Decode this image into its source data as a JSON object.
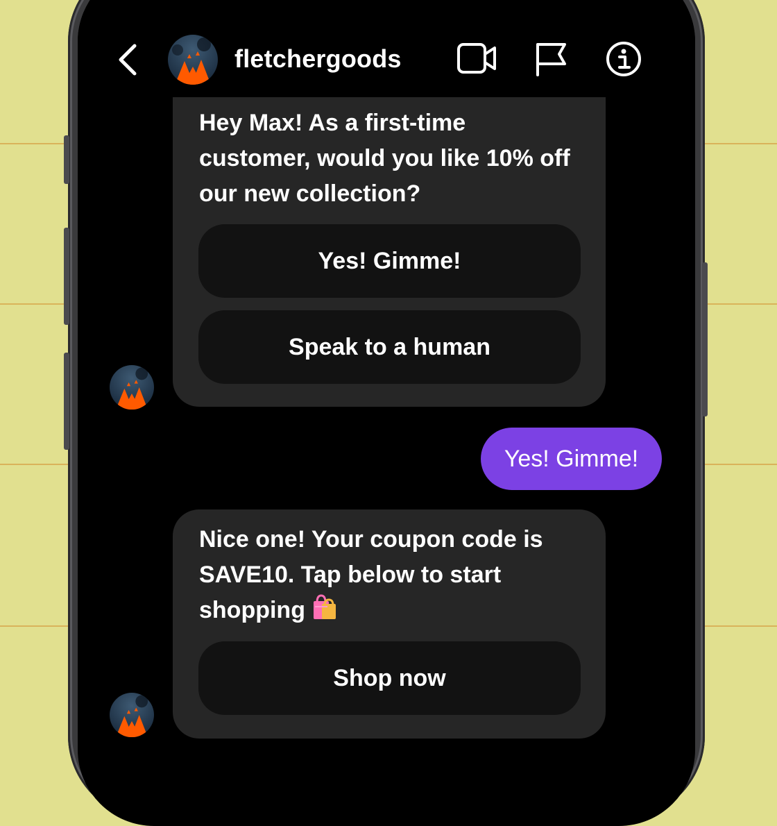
{
  "header": {
    "back_icon": "chevron-left-icon",
    "username": "fletchergoods",
    "video_icon": "video-camera-icon",
    "flag_icon": "flag-icon",
    "info_icon": "info-icon"
  },
  "messages": [
    {
      "from": "business",
      "text": "Hey Max! As a first-time customer, would you like 10% off our new collection?",
      "quick_replies": [
        "Yes! Gimme!",
        "Speak to a human"
      ]
    },
    {
      "from": "user",
      "text": "Yes! Gimme!"
    },
    {
      "from": "business",
      "text": "Nice one! Your coupon code is SAVE10. Tap below to start shopping",
      "emoji_icon": "shopping-bags-icon",
      "button": "Shop now"
    }
  ],
  "colors": {
    "background": "#e1e08f",
    "screen": "#000000",
    "bubble": "#262626",
    "button": "#121212",
    "sent_bubble": "#7c41e4",
    "avatar_accent": "#ff5a00"
  }
}
